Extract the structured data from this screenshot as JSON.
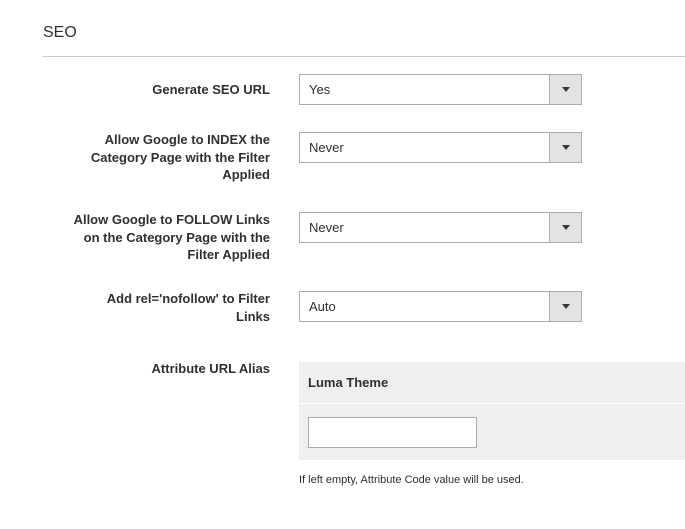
{
  "section": {
    "title": "SEO"
  },
  "fields": {
    "generate_seo_url": {
      "label": "Generate SEO URL",
      "value": "Yes"
    },
    "allow_index": {
      "label_lines": [
        "Allow Google to INDEX the",
        "Category Page with the Filter",
        "Applied"
      ],
      "value": "Never"
    },
    "allow_follow": {
      "label_lines": [
        "Allow Google to FOLLOW Links",
        "on the Category Page with the",
        "Filter Applied"
      ],
      "value": "Never"
    },
    "nofollow": {
      "label_lines": [
        "Add rel='nofollow' to Filter",
        "Links"
      ],
      "value": "Auto"
    },
    "attribute_alias": {
      "label": "Attribute URL Alias",
      "store_name": "Luma Theme",
      "input_value": "",
      "note": "If left empty, Attribute Code value will be used."
    }
  }
}
